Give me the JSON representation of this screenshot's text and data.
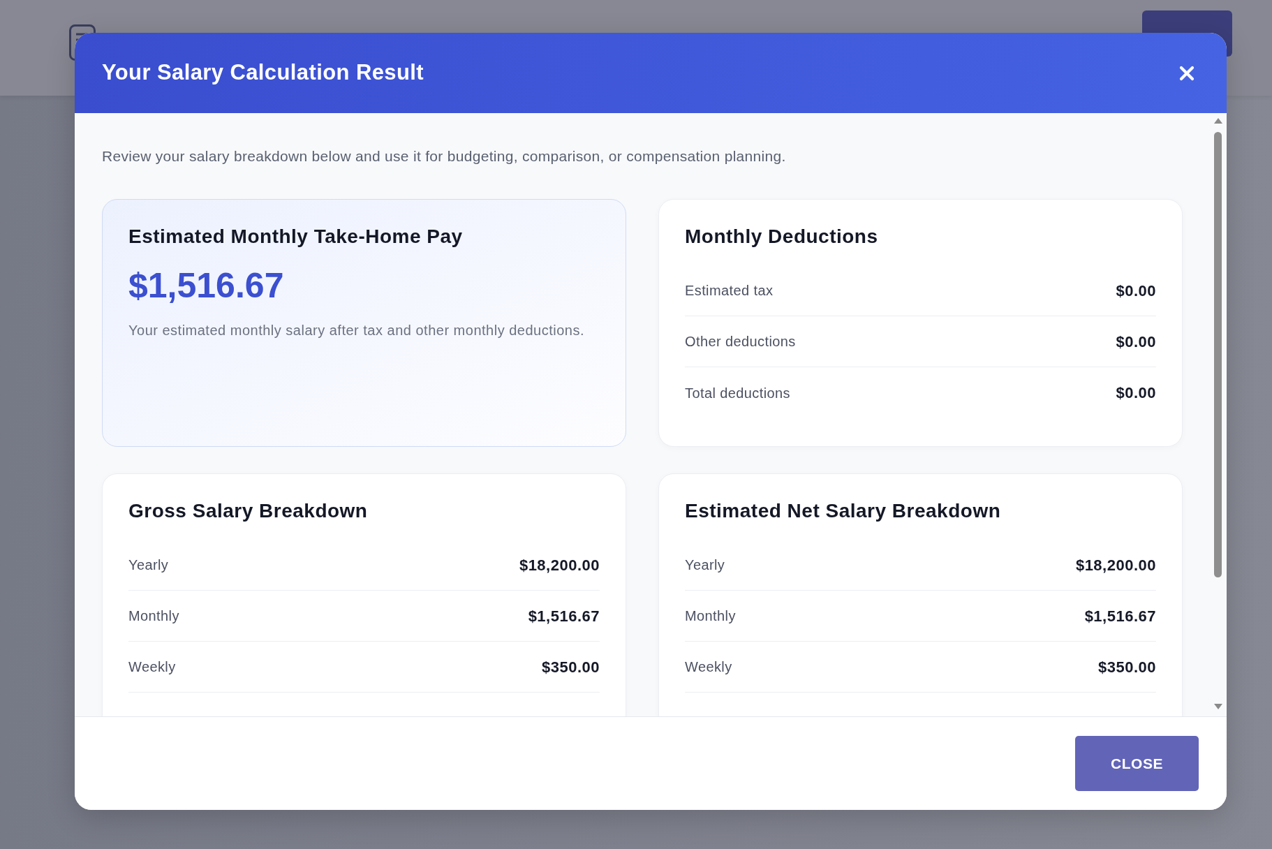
{
  "dialog": {
    "title": "Your Salary Calculation Result",
    "intro": "Review your salary breakdown below and use it for budgeting, comparison, or compensation planning.",
    "cards": [
      {
        "kind": "highlight",
        "title": "Estimated Monthly Take-Home Pay",
        "amount": "$1,516.67",
        "note": "Your estimated monthly salary after tax and other monthly deductions."
      },
      {
        "kind": "breakdown",
        "title": "Monthly Deductions",
        "cut_off": false,
        "rows": [
          {
            "label": "Estimated tax",
            "value": "$0.00"
          },
          {
            "label": "Other deductions",
            "value": "$0.00"
          },
          {
            "label": "Total deductions",
            "value": "$0.00"
          }
        ]
      },
      {
        "kind": "breakdown",
        "title": "Gross Salary Breakdown",
        "cut_off": true,
        "rows": [
          {
            "label": "Yearly",
            "value": "$18,200.00"
          },
          {
            "label": "Monthly",
            "value": "$1,516.67"
          },
          {
            "label": "Weekly",
            "value": "$350.00"
          }
        ]
      },
      {
        "kind": "breakdown",
        "title": "Estimated Net Salary Breakdown",
        "cut_off": true,
        "rows": [
          {
            "label": "Yearly",
            "value": "$18,200.00"
          },
          {
            "label": "Monthly",
            "value": "$1,516.67"
          },
          {
            "label": "Weekly",
            "value": "$350.00"
          }
        ]
      }
    ],
    "close_button": "CLOSE"
  }
}
